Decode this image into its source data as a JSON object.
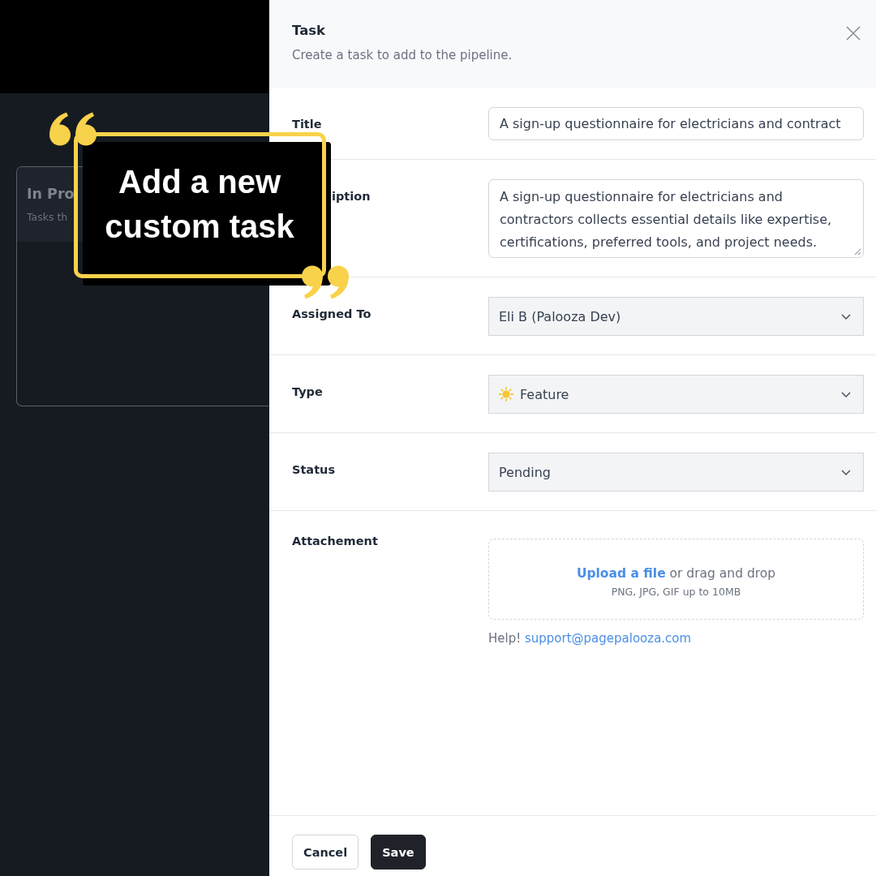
{
  "board": {
    "column": {
      "title": "In Pro",
      "subtitle": "Tasks th"
    }
  },
  "callout": {
    "text": "Add a new custom task"
  },
  "panel": {
    "title": "Task",
    "subtitle": "Create a task to add to the pipeline."
  },
  "fields": [
    {
      "kind": "text",
      "label": "Title",
      "value": "A sign-up questionnaire for electricians and contract"
    },
    {
      "kind": "textarea",
      "label": "iption",
      "value": "A sign-up questionnaire for electricians and contractors collects essential details like expertise, certifications, preferred tools, and project needs."
    },
    {
      "kind": "select",
      "label": "Assigned To",
      "value": "Eli B (Palooza Dev)",
      "with_icon": false
    },
    {
      "kind": "select",
      "label": "Type",
      "value": "Feature",
      "with_icon": true
    },
    {
      "kind": "select",
      "label": "Status",
      "value": "Pending",
      "with_icon": false
    },
    {
      "kind": "upload",
      "label": "Attachement",
      "link": "Upload a file",
      "text": "or drag and drop",
      "hint": "PNG, JPG, GIF up to 10MB",
      "help_label": "Help!",
      "help_email": "support@pagepalooza.com"
    }
  ],
  "buttons": [
    {
      "kind": "secondary",
      "label": "Cancel"
    },
    {
      "kind": "primary",
      "label": "Save"
    }
  ]
}
